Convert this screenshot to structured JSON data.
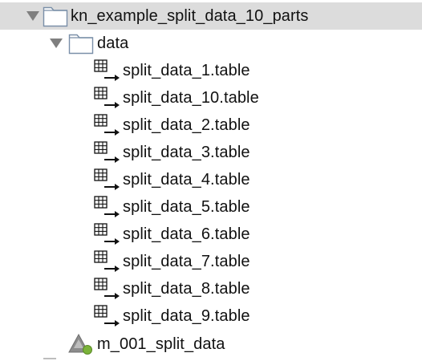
{
  "tree": {
    "project": {
      "label": "kn_example_split_data_10_parts",
      "expanded": true,
      "selected": true
    },
    "data_folder": {
      "label": "data",
      "expanded": true
    },
    "tables": [
      {
        "label": "split_data_1.table"
      },
      {
        "label": "split_data_10.table"
      },
      {
        "label": "split_data_2.table"
      },
      {
        "label": "split_data_3.table"
      },
      {
        "label": "split_data_4.table"
      },
      {
        "label": "split_data_5.table"
      },
      {
        "label": "split_data_6.table"
      },
      {
        "label": "split_data_7.table"
      },
      {
        "label": "split_data_8.table"
      },
      {
        "label": "split_data_9.table"
      }
    ],
    "workflow": {
      "label": "m_001_split_data"
    }
  },
  "colors": {
    "selection": "#dcdcdc",
    "folder_stroke": "#7a8fa8",
    "folder_fill": "#ffffff",
    "twisty": "#7f7f7f",
    "table_icon": "#111111",
    "workflow_icon_green": "#7bb33a",
    "workflow_icon_gray": "#8c8c8c"
  },
  "icons": {
    "twisty": "triangle-down-icon",
    "folder": "folder-icon",
    "table": "table-icon",
    "workflow": "workflow-icon"
  }
}
